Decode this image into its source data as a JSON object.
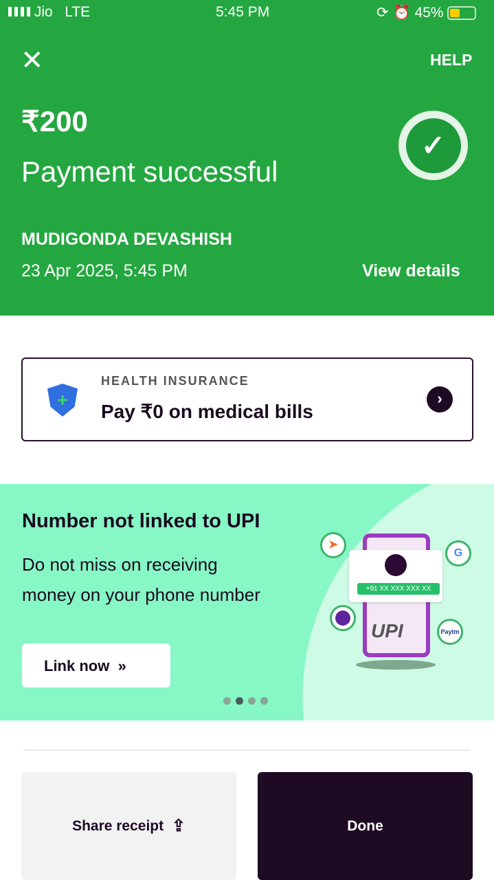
{
  "status_bar": {
    "carrier": "Jio",
    "network": "LTE",
    "time": "5:45 PM",
    "battery": "45%"
  },
  "header": {
    "help": "HELP",
    "amount": "₹200",
    "status": "Payment successful",
    "payee": "MUDIGONDA DEVASHISH",
    "datetime": "23 Apr 2025, 5:45 PM",
    "view_details": "View details"
  },
  "insurance": {
    "label": "HEALTH INSURANCE",
    "title": "Pay ₹0 on medical bills"
  },
  "banner": {
    "title": "Number not linked to UPI",
    "line1": "Do not miss on receiving",
    "line2": "money on your phone number",
    "cta": "Link now",
    "phone": "+91 XX XXX XXX XX",
    "upi": "UPI",
    "paytm": "Paytm",
    "carousel_active": 2,
    "carousel_total": 4
  },
  "actions": {
    "share": "Share receipt",
    "done": "Done"
  }
}
